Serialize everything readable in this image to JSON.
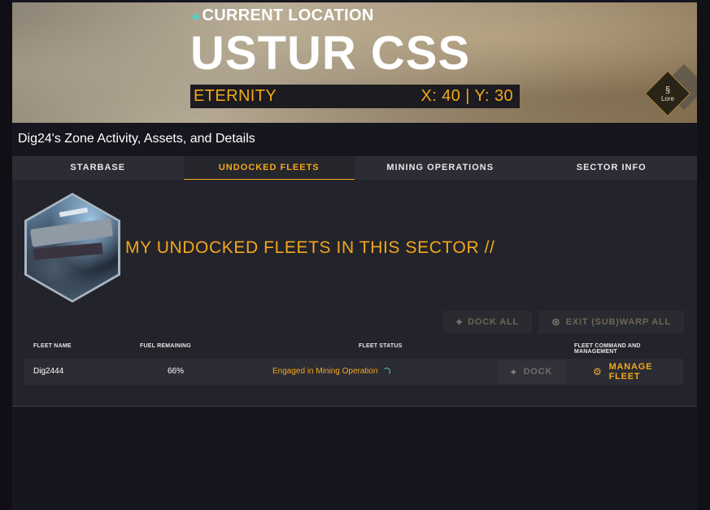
{
  "header": {
    "current_location_label": "CURRENT LOCATION",
    "location_name": "USTUR CSS",
    "region": "ETERNITY",
    "coordinates": "X: 40 | Y: 30",
    "lore_label": "Lore"
  },
  "zone_title": "Dig24's Zone Activity, Assets, and Details",
  "tabs": [
    {
      "label": "STARBASE",
      "active": false
    },
    {
      "label": "UNDOCKED FLEETS",
      "active": true
    },
    {
      "label": "MINING OPERATIONS",
      "active": false
    },
    {
      "label": "SECTOR INFO",
      "active": false
    }
  ],
  "section_heading": "MY UNDOCKED FLEETS IN THIS SECTOR //",
  "bulk_actions": {
    "dock_all": "DOCK ALL",
    "exit_warp_all": "EXIT (SUB)WARP ALL"
  },
  "table": {
    "headers": {
      "fleet_name": "FLEET NAME",
      "fuel_remaining": "FUEL REMAINING",
      "fleet_status": "FLEET STATUS",
      "command": "FLEET COMMAND AND MANAGEMENT"
    },
    "rows": [
      {
        "name": "Dig2444",
        "fuel": "66%",
        "status": "Engaged in Mining Operation",
        "dock_label": "DOCK",
        "manage_label": "MANAGE FLEET"
      }
    ]
  },
  "colors": {
    "accent": "#f3a81b",
    "teal": "#4ed3c8",
    "background": "#16161f",
    "panel": "#23232b"
  },
  "icons": [
    "diamond-icon",
    "lore-icon",
    "location-pin-icon",
    "warp-exit-icon",
    "gear-icon",
    "spinner-icon"
  ]
}
